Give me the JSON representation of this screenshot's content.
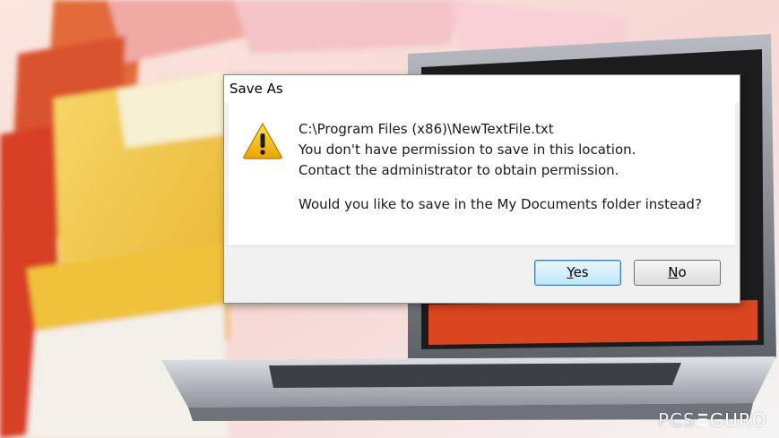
{
  "dialog": {
    "title": "Save As",
    "path": "C:\\Program Files (x86)\\NewTextFile.txt",
    "line1": "You don't have permission to save in this location.",
    "line2": "Contact the administrator to obtain permission.",
    "question": "Would you like to save in the My Documents folder instead?",
    "yes_label": "Yes",
    "no_label": "No",
    "yes_mnemonic": "Y",
    "yes_rest": "es",
    "no_mnemonic": "N",
    "no_rest": "o"
  },
  "watermark": {
    "pcs": "PCS",
    "guro": "GURO"
  },
  "icons": {
    "warning": "warning-icon",
    "security": "security-icon"
  },
  "colors": {
    "folder_yellow": "#f2c94c",
    "folder_red": "#e2473a",
    "laptop_screen": "#d9461f",
    "button_focus": "#3c7fb1"
  }
}
